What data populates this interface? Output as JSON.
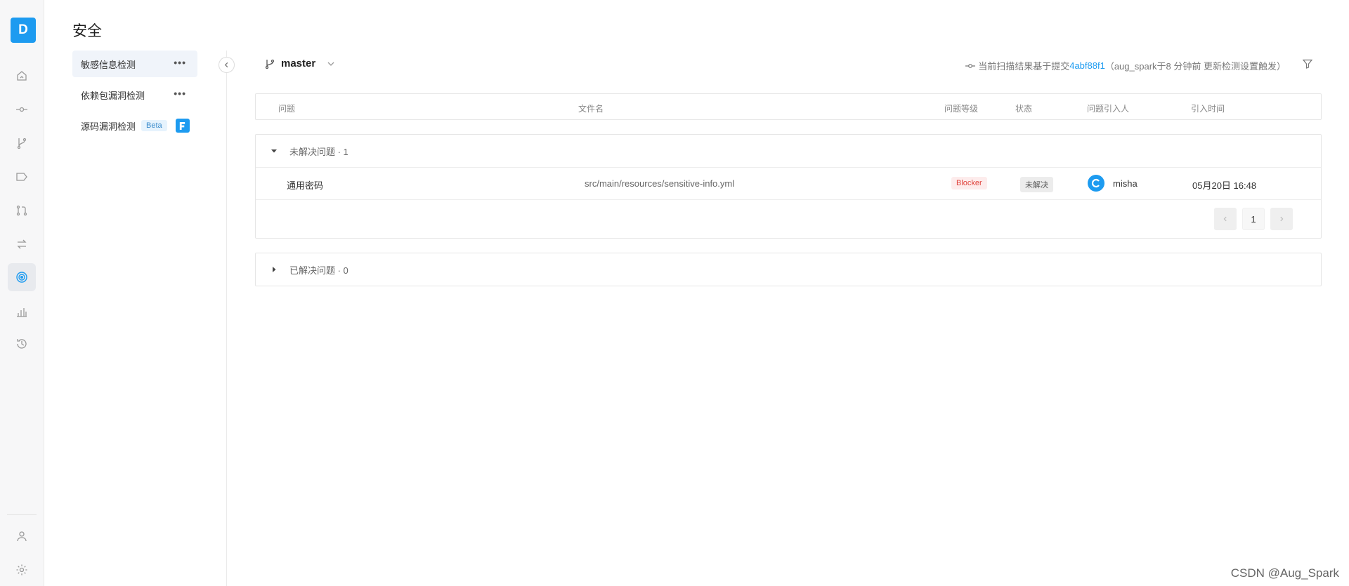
{
  "app": {
    "logo_letter": "D"
  },
  "rail": {
    "items": [
      {
        "icon": "home-icon"
      },
      {
        "icon": "commit-icon"
      },
      {
        "icon": "branch-icon"
      },
      {
        "icon": "tag-icon"
      },
      {
        "icon": "merge-request-icon"
      },
      {
        "icon": "sync-icon"
      },
      {
        "icon": "security-icon",
        "active": true
      },
      {
        "icon": "stats-icon"
      },
      {
        "icon": "history-icon"
      }
    ],
    "bottom": [
      {
        "icon": "user-icon"
      },
      {
        "icon": "settings-icon"
      }
    ]
  },
  "page": {
    "title": "安全"
  },
  "submenu": {
    "items": [
      {
        "label": "敏感信息检测",
        "active": true
      },
      {
        "label": "依赖包漏洞检测"
      },
      {
        "label": "源码漏洞检测",
        "badge": "Beta"
      }
    ]
  },
  "branch": {
    "name": "master"
  },
  "scan": {
    "prefix": "当前扫描结果基于提交",
    "commit": "4abf88f1",
    "suffix": "（aug_spark于8 分钟前 更新检测设置触发）"
  },
  "table": {
    "columns": [
      "问题",
      "文件名",
      "问题等级",
      "状态",
      "问题引入人",
      "引入时间"
    ]
  },
  "unresolved": {
    "title": "未解决问题 · 1",
    "rows": [
      {
        "issue": "通用密码",
        "file": "src/main/resources/sensitive-info.yml",
        "level": "Blocker",
        "status": "未解决",
        "author": "misha",
        "time": "05月20日 16:48"
      }
    ],
    "pagination": {
      "current": "1"
    }
  },
  "resolved": {
    "title": "已解决问题 · 0"
  },
  "watermark": "CSDN @Aug_Spark",
  "colors": {
    "accent": "#1d9bf0",
    "blocker": "#e0443d"
  }
}
